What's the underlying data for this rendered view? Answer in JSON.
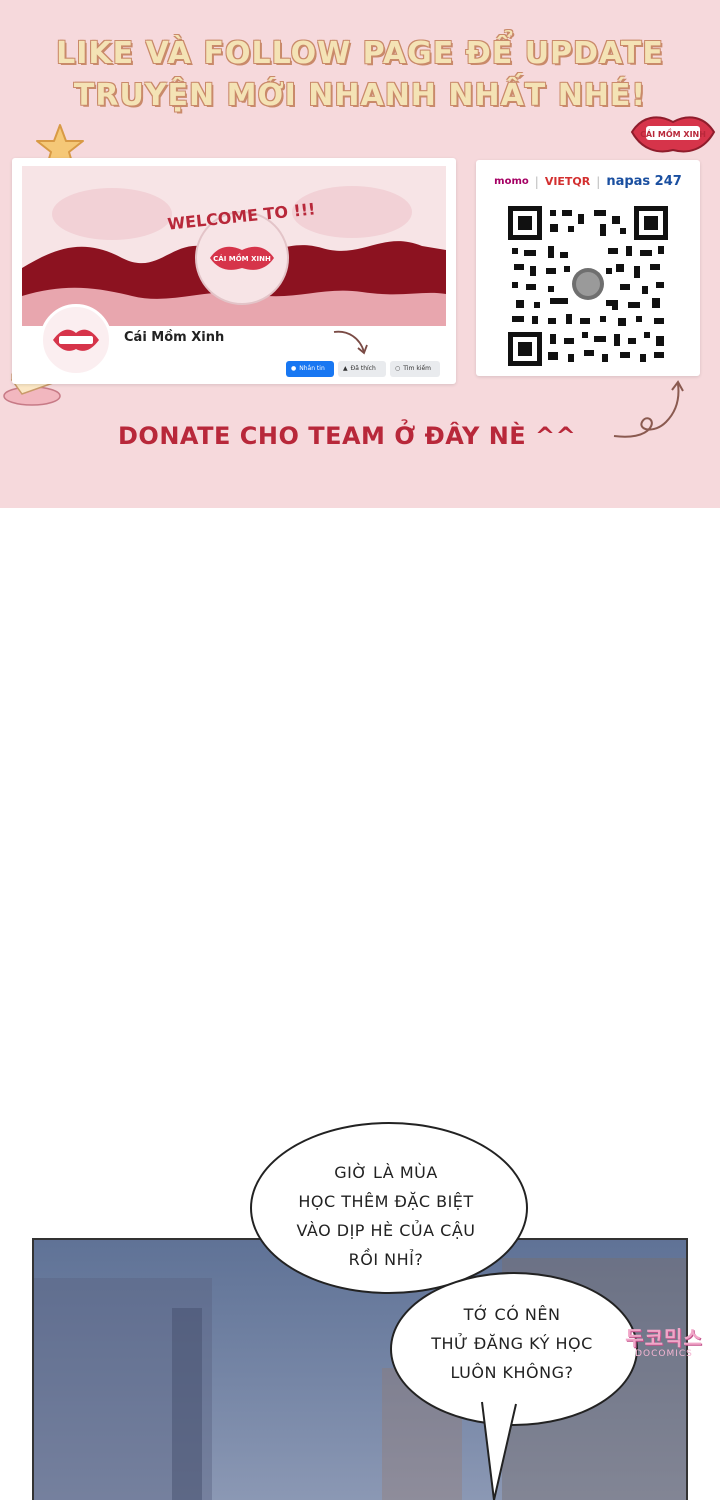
{
  "banner": {
    "headline_line1": "LIKE VÀ FOLLOW PAGE ĐỂ UPDATE",
    "headline_line2": "TRUYỆN MỚI NHANH NHẤT NHÉ!",
    "donate_text": "DONATE CHO TEAM Ở ĐÂY NÈ ^^",
    "badge_text": "CÁI MỒM XINH",
    "colors": {
      "background": "#f6d9dc",
      "donate": "#b8283a",
      "headline": "#f4e3b5"
    }
  },
  "facebook_card": {
    "cover_text": "WELCOME TO !!!",
    "cover_logo": "CÁI MỒM XINH",
    "page_name": "Cái Mồm Xinh",
    "buttons": {
      "message": "Nhắn tin",
      "liked": "Đã thích",
      "search": "Tìm kiếm"
    }
  },
  "qr_card": {
    "providers": [
      "momo",
      "VIETQR",
      "napas 247"
    ]
  },
  "comic": {
    "bubble1_lines": [
      "GIỜ LÀ MÙA",
      "HỌC THÊM ĐẶC BIỆT",
      "VÀO DỊP HÈ CỦA CẬU",
      "RỒI NHỈ?"
    ],
    "bubble2_lines": [
      "TỚ CÓ NÊN",
      "THỬ ĐĂNG KÝ HỌC",
      "LUÔN KHÔNG?"
    ],
    "watermark_main": "두코믹스",
    "watermark_sub": "DOCOMICS"
  }
}
